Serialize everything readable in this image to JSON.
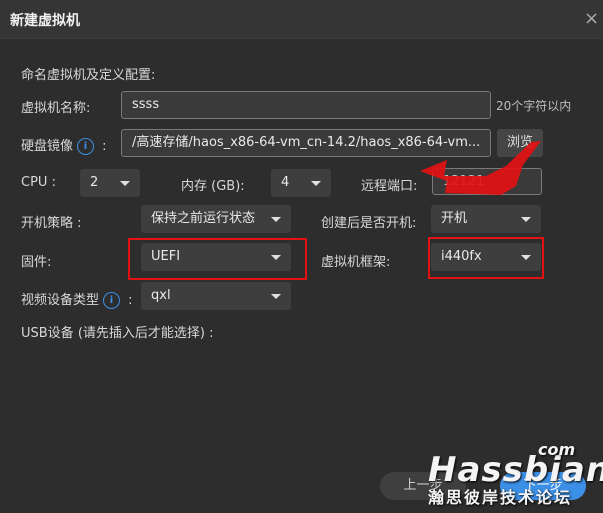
{
  "dialog": {
    "title": "新建虚拟机",
    "close_symbol": "×"
  },
  "form": {
    "section_label": "命名虚拟机及定义配置:",
    "name": {
      "label": "虚拟机名称:",
      "value": "ssss",
      "hint": "20个字符以内"
    },
    "disk_image": {
      "label": "硬盘镜像",
      "colon": ":",
      "info_symbol": "i",
      "value": "/高速存储/haos_x86-64-vm_cn-14.2/haos_x86-64-vm...",
      "browse_label": "浏览"
    },
    "cpu": {
      "label": "CPU :",
      "value": "2"
    },
    "memory": {
      "label": "内存 (GB):",
      "value": "4"
    },
    "remote_port": {
      "label": "远程端口:",
      "value": "12121"
    },
    "boot_policy": {
      "label": "开机策略 :",
      "value": "保持之前运行状态"
    },
    "start_after_create": {
      "label": "创建后是否开机:",
      "value": "开机"
    },
    "firmware": {
      "label": "固件:",
      "value": "UEFI"
    },
    "vm_chipset": {
      "label": "虚拟机框架:",
      "value": "i440fx"
    },
    "video_device": {
      "label": "视频设备类型",
      "info_symbol": "i",
      "colon": ":",
      "value": "qxl"
    },
    "usb": {
      "label": "USB设备 (请先插入后才能选择) :"
    }
  },
  "footer": {
    "prev_label": "上一步",
    "next_label": "下一步"
  },
  "watermark": {
    "main": "Hassbian",
    "com": "com",
    "sub": "瀚思彼岸技术论坛"
  },
  "colors": {
    "accent": "#3c8fe6",
    "highlight": "#e31212"
  }
}
